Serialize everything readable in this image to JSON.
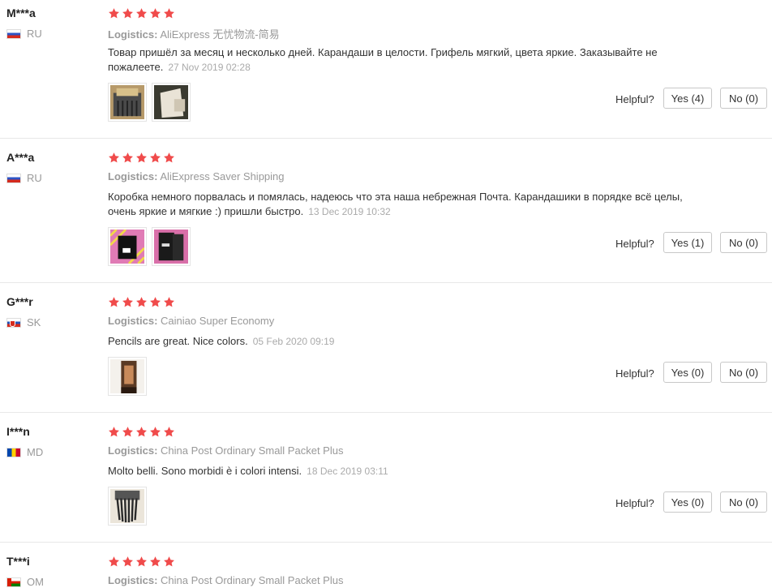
{
  "reviews": [
    {
      "user": "M***a",
      "country": "RU",
      "flag": "ru",
      "rating": 5,
      "logistics_label": "Logistics:",
      "logistics": "AliExpress 无忧物流-简易",
      "text": "Товар пришёл за месяц и несколько дней. Карандаши в целости. Грифель мягкий, цвета яркие. Заказывайте не пожалеете.",
      "date": "27 Nov 2019 02:28",
      "helpful_label": "Helpful?",
      "yes_label": "Yes (4)",
      "no_label": "No (0)"
    },
    {
      "user": "A***a",
      "country": "RU",
      "flag": "ru",
      "rating": 5,
      "logistics_label": "Logistics:",
      "logistics": "AliExpress Saver Shipping",
      "text": "Коробка немного порвалась и помялась, надеюсь что эта наша небрежная Почта. Карандашики в порядке всё целы, очень яркие и мягкие :) пришли быстро.",
      "date": "13 Dec 2019 10:32",
      "helpful_label": "Helpful?",
      "yes_label": "Yes (1)",
      "no_label": "No (0)"
    },
    {
      "user": "G***r",
      "country": "SK",
      "flag": "sk",
      "rating": 5,
      "logistics_label": "Logistics:",
      "logistics": "Cainiao Super Economy",
      "text": "Pencils are great. Nice colors.",
      "date": "05 Feb 2020 09:19",
      "helpful_label": "Helpful?",
      "yes_label": "Yes (0)",
      "no_label": "No (0)"
    },
    {
      "user": "I***n",
      "country": "MD",
      "flag": "md",
      "rating": 5,
      "logistics_label": "Logistics:",
      "logistics": "China Post Ordinary Small Packet Plus",
      "text": "Molto belli. Sono morbidi è i colori intensi.",
      "date": "18 Dec 2019 03:11",
      "helpful_label": "Helpful?",
      "yes_label": "Yes (0)",
      "no_label": "No (0)"
    },
    {
      "user": "T***i",
      "country": "OM",
      "flag": "om",
      "rating": 5,
      "logistics_label": "Logistics:",
      "logistics": "China Post Ordinary Small Packet Plus"
    }
  ],
  "colors": {
    "star": "#f04b4b",
    "muted": "#999999",
    "border": "#e8e8e8"
  }
}
